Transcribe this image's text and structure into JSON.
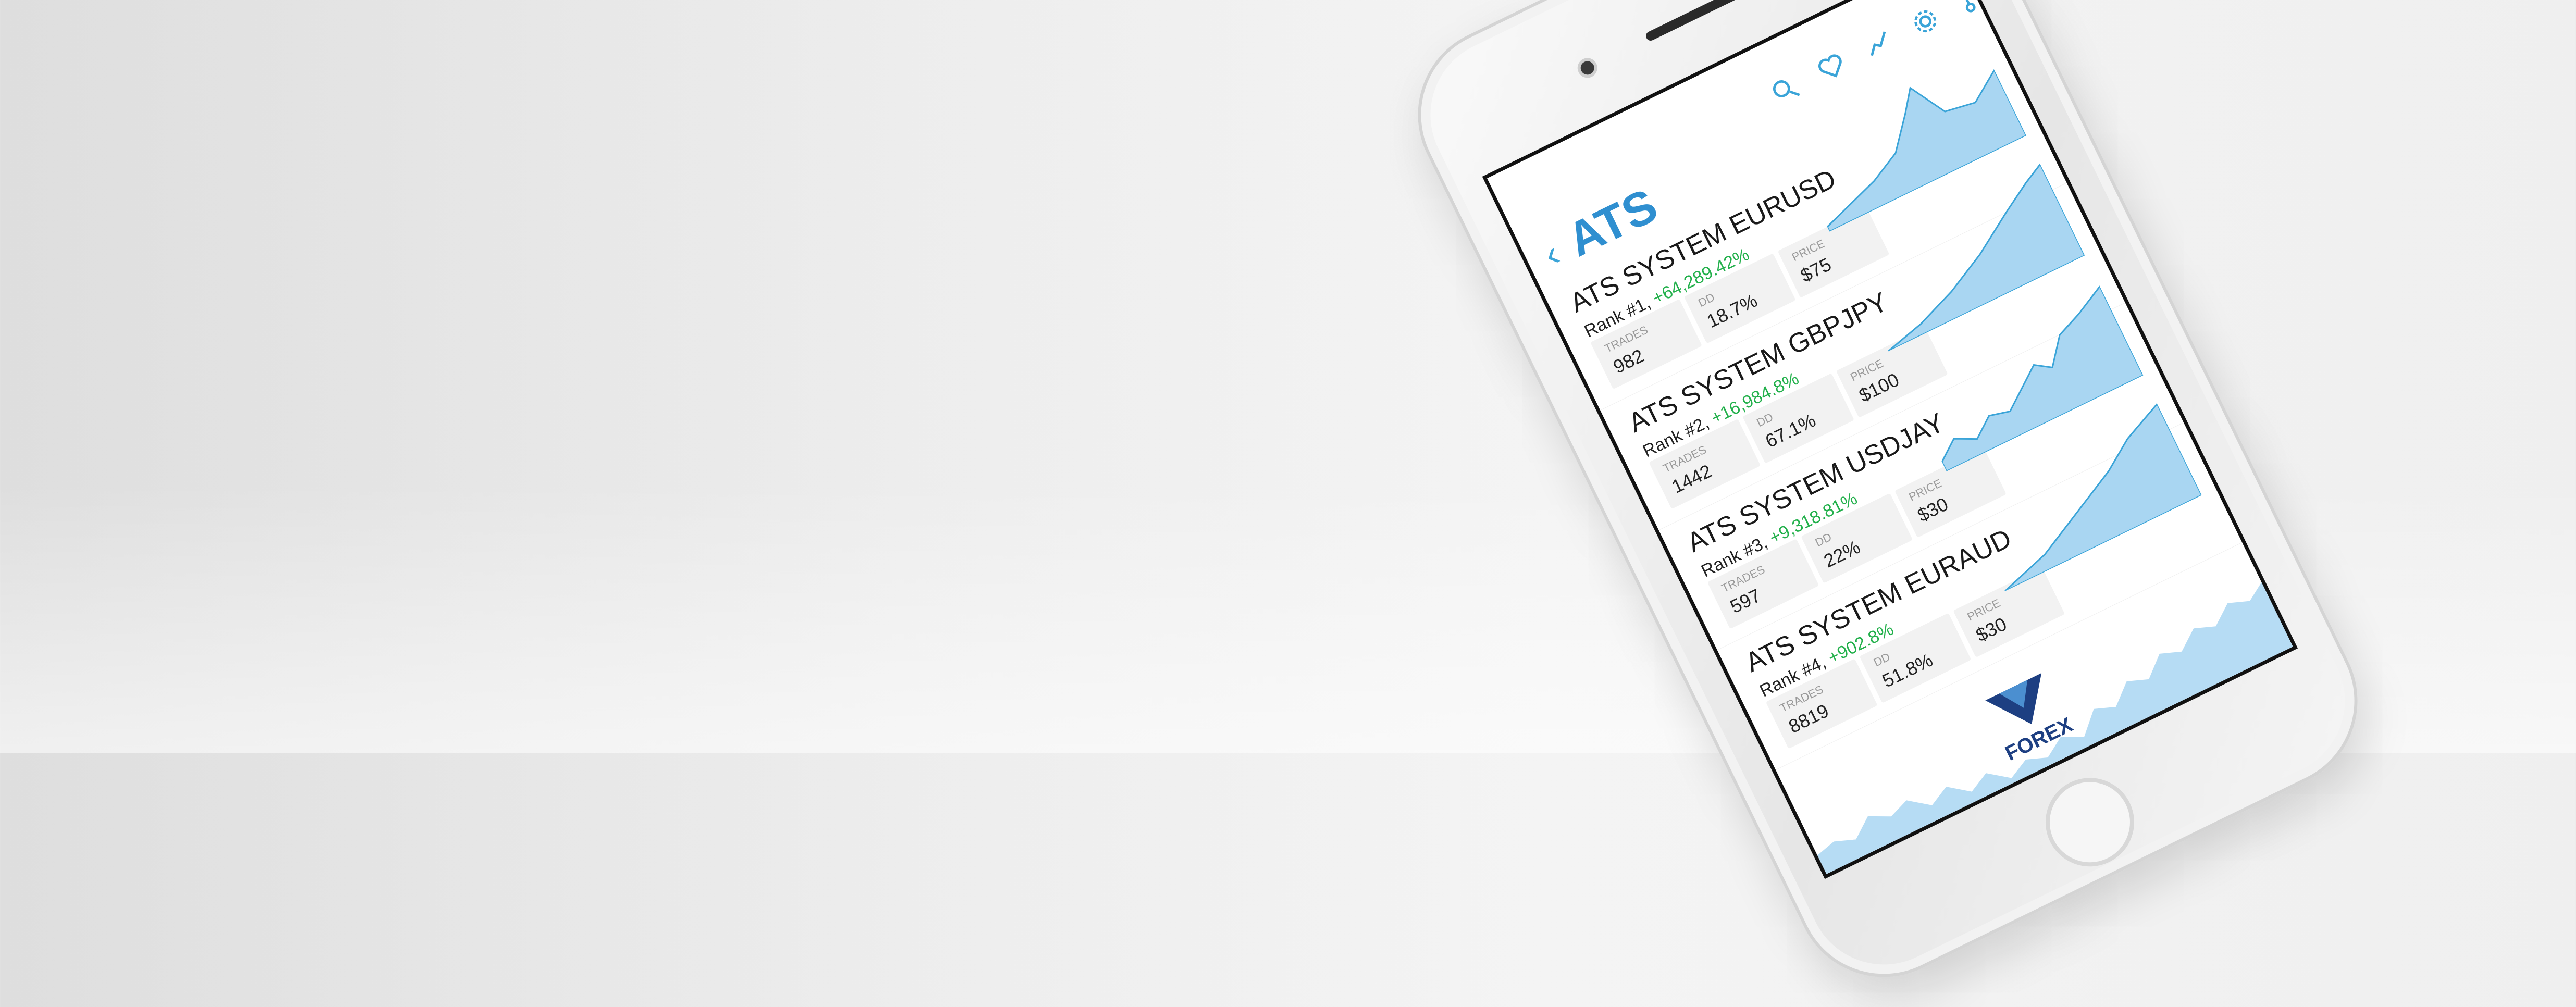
{
  "app": {
    "title": "ATS"
  },
  "toolbar": {
    "icons": [
      "search-icon",
      "heart-icon",
      "trend-icon",
      "gear-icon",
      "link-icon"
    ]
  },
  "systems": [
    {
      "name": "ATS SYSTEM EURUSD",
      "rank": "Rank #1,",
      "pct": "+64,289.42%",
      "trades_label": "TRADES",
      "trades": "982",
      "dd_label": "DD",
      "dd": "18.7%",
      "price_label": "PRICE",
      "price": "$75"
    },
    {
      "name": "ATS SYSTEM GBPJPY",
      "rank": "Rank #2,",
      "pct": "+16,984.8%",
      "trades_label": "TRADES",
      "trades": "1442",
      "dd_label": "DD",
      "dd": "67.1%",
      "price_label": "PRICE",
      "price": "$100"
    },
    {
      "name": "ATS SYSTEM  USDJAY",
      "rank": "Rank #3,",
      "pct": "+9,318.81%",
      "trades_label": "TRADES",
      "trades": "597",
      "dd_label": "DD",
      "dd": "22%",
      "price_label": "PRICE",
      "price": "$30"
    },
    {
      "name": "ATS SYSTEM EURAUD",
      "rank": "Rank #4,",
      "pct": "+902.8%",
      "trades_label": "TRADES",
      "trades": "8819",
      "dd_label": "DD",
      "dd": "51.8%",
      "price_label": "PRICE",
      "price": "$30"
    }
  ],
  "logo": {
    "text": "FOREX"
  },
  "colors": {
    "accent": "#2f8fd0",
    "positive": "#22b04b",
    "chart_fill": "#a9d6f2",
    "chart_stroke": "#3aa4d8"
  }
}
